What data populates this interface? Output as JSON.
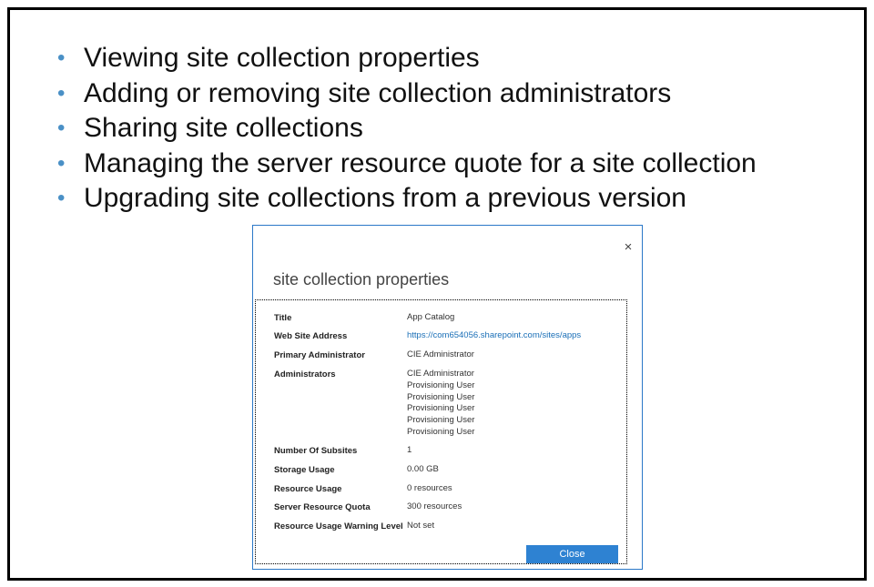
{
  "bullets": [
    "Viewing site collection properties",
    "Adding or removing site collection administrators",
    "Sharing site collections",
    "Managing the server resource quote for a site collection",
    "Upgrading site collections from a previous version"
  ],
  "dialog": {
    "title": "site collection properties",
    "close_icon": "×",
    "properties": {
      "title_label": "Title",
      "title_value": "App Catalog",
      "address_label": "Web Site Address",
      "address_value": "https://com654056.sharepoint.com/sites/apps",
      "primary_admin_label": "Primary Administrator",
      "primary_admin_value": "CIE Administrator",
      "admins_label": "Administrators",
      "admins": [
        "CIE Administrator",
        "Provisioning User",
        "Provisioning User",
        "Provisioning User",
        "Provisioning User",
        "Provisioning User"
      ],
      "subsites_label": "Number Of Subsites",
      "subsites_value": "1",
      "storage_label": "Storage Usage",
      "storage_value": "0.00 GB",
      "resource_usage_label": "Resource Usage",
      "resource_usage_value": "0 resources",
      "quota_label": "Server Resource Quota",
      "quota_value": "300 resources",
      "warning_label": "Resource Usage Warning Level",
      "warning_value": "Not set"
    },
    "close_button_label": "Close"
  },
  "colors": {
    "bullet": "#4a90c6",
    "link": "#1a6fb7",
    "button": "#2e82d2",
    "dialog_border": "#2b78c8"
  }
}
